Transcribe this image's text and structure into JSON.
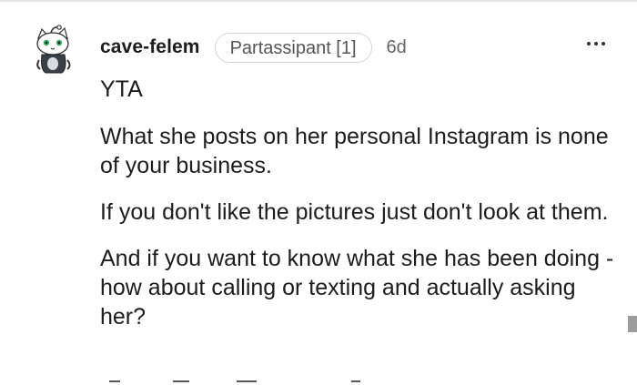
{
  "comment": {
    "username": "cave-felem",
    "flair": "Partassipant [1]",
    "timestamp": "6d",
    "paragraphs": [
      "YTA",
      "What she posts on her personal Instagram is none of your business.",
      "If you don't like the pictures just don't look at them.",
      "And if you want to know what she has been doing - how about calling or texting and actually asking her?"
    ]
  },
  "icons": {
    "avatar": "snoo-cat-avatar",
    "more": "more-options-icon",
    "actions": [
      "upvote-icon",
      "reply-icon",
      "award-icon",
      "share-icon"
    ]
  },
  "colors": {
    "text": "#1c1c1c",
    "muted": "#666666",
    "divider": "#e6e6e6"
  }
}
